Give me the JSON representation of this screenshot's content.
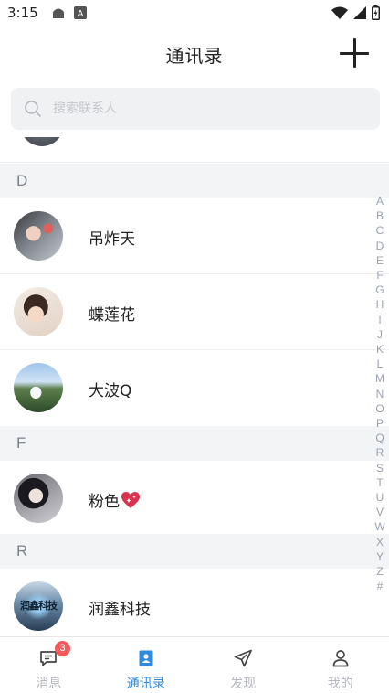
{
  "status_bar": {
    "time": "3:15"
  },
  "header": {
    "title": "通讯录"
  },
  "search": {
    "placeholder": "搜索联系人"
  },
  "sections": [
    {
      "letter": "D",
      "contacts": [
        {
          "name": "吊炸天"
        },
        {
          "name": "蝶莲花"
        },
        {
          "name": "大波Q"
        }
      ]
    },
    {
      "letter": "F",
      "contacts": [
        {
          "name": "粉色"
        }
      ]
    },
    {
      "letter": "R",
      "contacts": [
        {
          "name": "润鑫科技"
        }
      ]
    }
  ],
  "avatar_text": "润鑫科技",
  "alphabet": [
    "A",
    "B",
    "C",
    "D",
    "E",
    "F",
    "G",
    "H",
    "I",
    "J",
    "K",
    "L",
    "M",
    "N",
    "O",
    "P",
    "Q",
    "R",
    "S",
    "T",
    "U",
    "V",
    "W",
    "X",
    "Y",
    "Z",
    "#"
  ],
  "bottom_nav": [
    {
      "label": "消息",
      "icon": "chat-bubble-icon",
      "badge": "3",
      "active": false
    },
    {
      "label": "通讯录",
      "icon": "contact-card-icon",
      "active": true
    },
    {
      "label": "发现",
      "icon": "paper-plane-icon",
      "active": false
    },
    {
      "label": "我的",
      "icon": "person-icon",
      "active": false
    }
  ],
  "colors": {
    "accent": "#2f8bdf",
    "badge": "#f25b5b",
    "section_bg": "#f3f4f6",
    "inactive": "#b5b8bd"
  }
}
